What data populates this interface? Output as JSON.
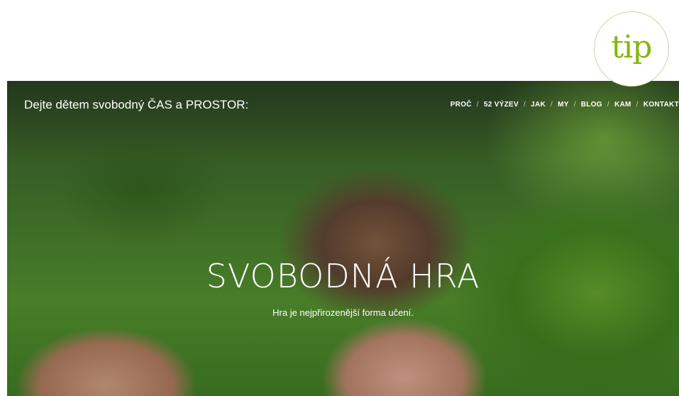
{
  "badge": {
    "text": "tip"
  },
  "site": {
    "title": "Dejte dětem svobodný ČAS a PROSTOR:"
  },
  "nav": {
    "items": [
      "PROČ",
      "52 VÝZEV",
      "JAK",
      "MY",
      "BLOG",
      "KAM",
      "KONTAKT"
    ],
    "separator": "/",
    "active": "PROČ"
  },
  "hero": {
    "title": "SVOBODNÁ HRA",
    "subtitle": "Hra je nejpřirozenější forma učení."
  }
}
